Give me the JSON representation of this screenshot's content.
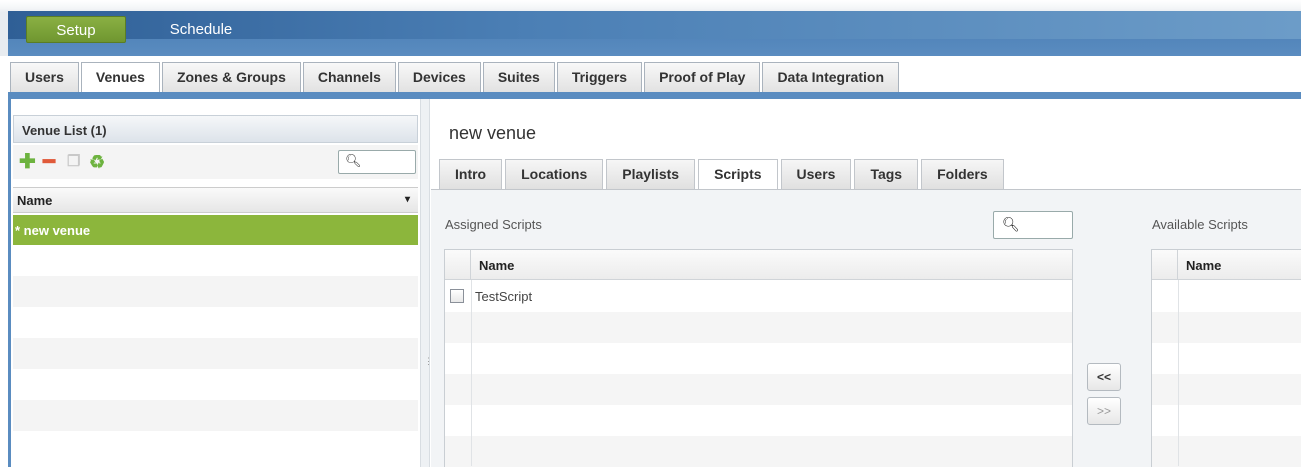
{
  "top_tabs": {
    "setup": "Setup",
    "schedule": "Schedule"
  },
  "sub_tabs": [
    "Users",
    "Venues",
    "Zones & Groups",
    "Channels",
    "Devices",
    "Suites",
    "Triggers",
    "Proof of Play",
    "Data Integration"
  ],
  "active_sub_tab": "Venues",
  "venue_list": {
    "title": "Venue List (1)",
    "column": "Name",
    "sort_icon": "▾",
    "items": [
      "* new venue"
    ],
    "search_placeholder": ""
  },
  "venue": {
    "title": "new venue",
    "tabs": [
      "Intro",
      "Locations",
      "Playlists",
      "Scripts",
      "Users",
      "Tags",
      "Folders"
    ],
    "active_tab": "Scripts"
  },
  "scripts": {
    "assigned_label": "Assigned Scripts",
    "available_label": "Available Scripts",
    "column": "Name",
    "assigned": [
      "TestScript"
    ],
    "move_left": "<<",
    "move_right": ">>"
  },
  "colors": {
    "accent_green": "#8cb63c",
    "header_blue": "#4f82b8"
  }
}
